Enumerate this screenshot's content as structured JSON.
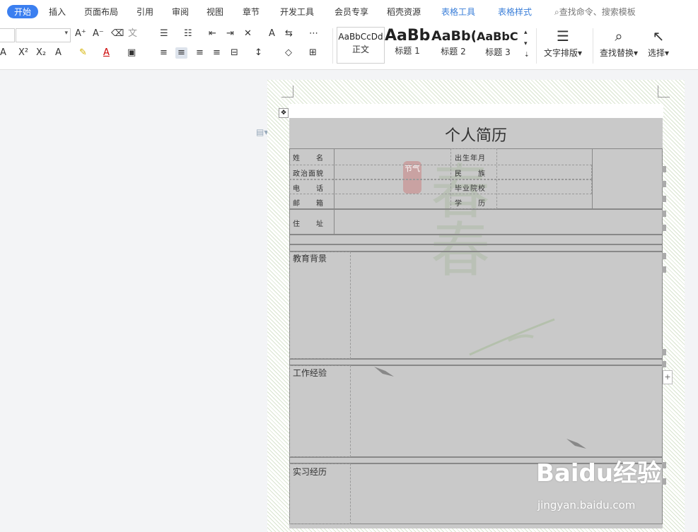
{
  "menubar": {
    "tabs": [
      "开始",
      "插入",
      "页面布局",
      "引用",
      "审阅",
      "视图",
      "章节",
      "开发工具",
      "会员专享",
      "稻壳资源",
      "表格工具",
      "表格样式"
    ],
    "active_tab": "开始",
    "search_label": "查找命令、搜索模板"
  },
  "ribbon": {
    "styles": [
      {
        "sample": "AaBbCcDd",
        "caption": "正文"
      },
      {
        "sample": "AaBb",
        "caption": "标题 1"
      },
      {
        "sample": "AaBb(",
        "caption": "标题 2"
      },
      {
        "sample": "AaBbC(",
        "caption": "标题 3"
      }
    ],
    "text_layout_label": "文字排版",
    "find_replace_label": "查找替换",
    "select_label": "选择"
  },
  "document": {
    "title": "个人简历",
    "fields": {
      "name": "姓　　名",
      "politics": "政治面貌",
      "phone": "电　　话",
      "email": "邮　　箱",
      "address": "住　　址",
      "birth": "出生年月",
      "ethnicity": "民　　族",
      "school": "毕业院校",
      "degree": "学　　历"
    },
    "sections": [
      "教育背景",
      "工作经验",
      "实习经历"
    ],
    "stamp_text": "节气",
    "ghost_char": "春"
  },
  "watermark": {
    "brand": "Baidu经验",
    "url": "jingyan.baidu.com"
  }
}
